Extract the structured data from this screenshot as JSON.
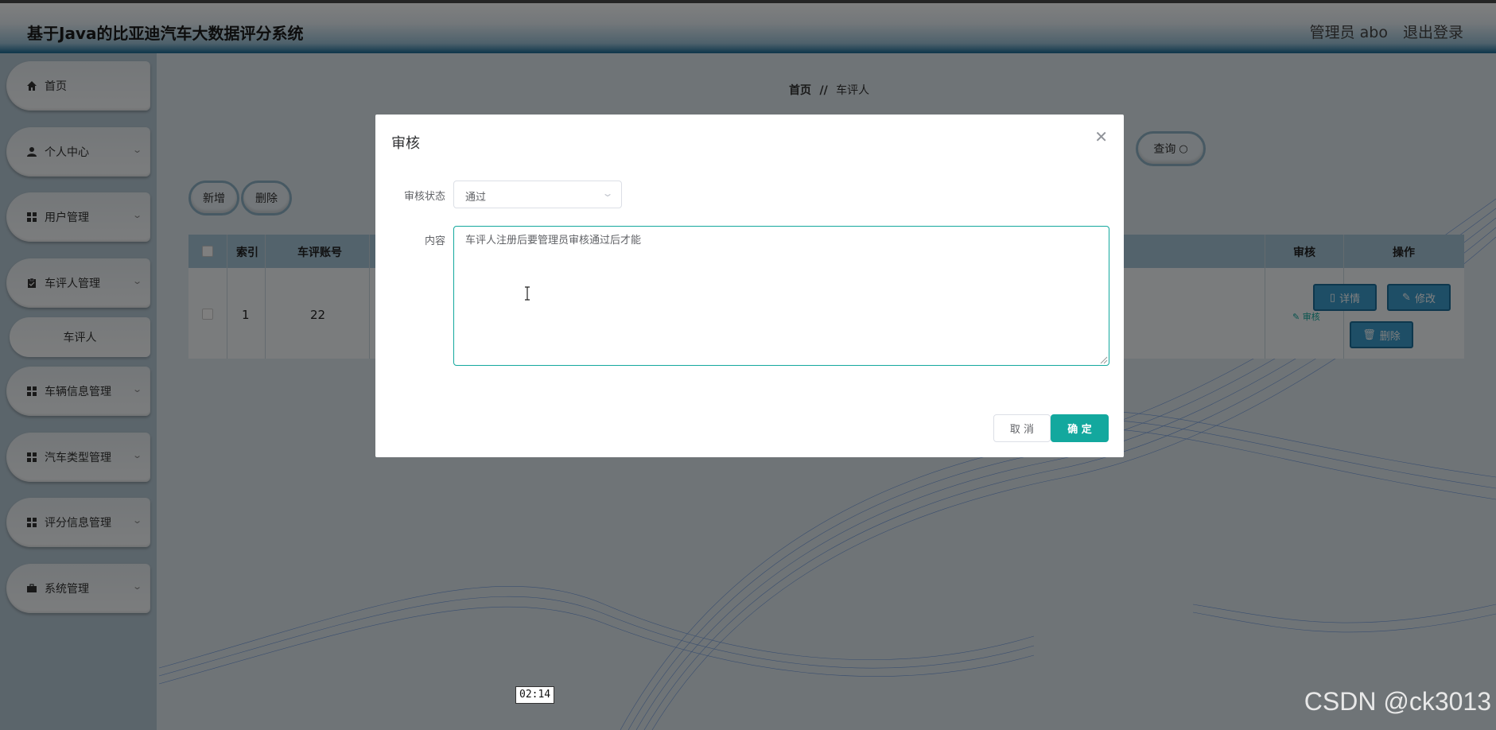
{
  "header": {
    "title": "基于Java的比亚迪汽车大数据评分系统",
    "user": "管理员 abo",
    "logout": "退出登录"
  },
  "sidebar": {
    "items": [
      {
        "label": "首页",
        "icon": "home-icon",
        "expandable": false
      },
      {
        "label": "个人中心",
        "icon": "person-icon",
        "expandable": true
      },
      {
        "label": "用户管理",
        "icon": "grid-icon",
        "expandable": true
      },
      {
        "label": "车评人管理",
        "icon": "clipboard-icon",
        "expandable": true
      },
      {
        "label": "车辆信息管理",
        "icon": "grid-icon",
        "expandable": true
      },
      {
        "label": "汽车类型管理",
        "icon": "grid-icon",
        "expandable": true
      },
      {
        "label": "评分信息管理",
        "icon": "grid-icon",
        "expandable": true
      },
      {
        "label": "系统管理",
        "icon": "briefcase-icon",
        "expandable": true
      }
    ],
    "subitem": "车评人"
  },
  "breadcrumb": {
    "home": "首页",
    "separator": "//",
    "current": "车评人"
  },
  "toolbar": {
    "query": "查询",
    "add": "新增",
    "delete": "删除"
  },
  "table": {
    "headers": {
      "index": "索引",
      "account": "车评账号",
      "audit": "审核",
      "ops": "操作"
    },
    "row": {
      "index": "1",
      "account": "22",
      "audit": "审核"
    },
    "buttons": {
      "detail": "详情",
      "edit": "修改",
      "delete": "删除"
    }
  },
  "modal": {
    "title": "审核",
    "status_label": "审核状态",
    "status_value": "通过",
    "content_label": "内容",
    "content_value": "车评人注册后要管理员审核通过后才能",
    "cancel": "取 消",
    "confirm": "确 定"
  },
  "overlay_text": {
    "timestamp": "02:14",
    "watermark": "CSDN @ck3013"
  },
  "colors": {
    "accent": "#13a89e",
    "header_blue": "#1b6c95",
    "table_header": "#a6c6d8"
  }
}
